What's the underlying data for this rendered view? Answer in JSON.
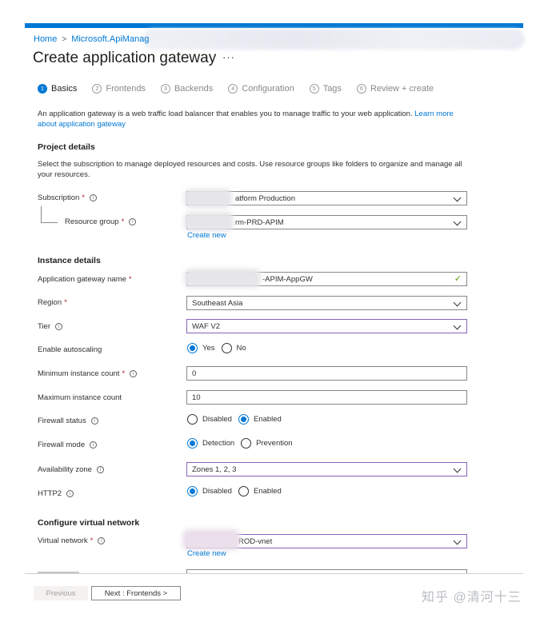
{
  "breadcrumb": {
    "home": "Home",
    "separator": ">",
    "resource": "Microsoft.ApiManag"
  },
  "page": {
    "title": "Create application gateway",
    "more": "···"
  },
  "steps": [
    {
      "num": "1",
      "label": "Basics",
      "active": true
    },
    {
      "num": "2",
      "label": "Frontends"
    },
    {
      "num": "3",
      "label": "Backends"
    },
    {
      "num": "4",
      "label": "Configuration"
    },
    {
      "num": "5",
      "label": "Tags"
    },
    {
      "num": "6",
      "label": "Review + create"
    }
  ],
  "intro": {
    "text": "An application gateway is a web traffic load balancer that enables you to manage traffic to your web application.",
    "link": "Learn more about application gateway"
  },
  "project": {
    "title": "Project details",
    "description": "Select the subscription to manage deployed resources and costs. Use resource groups like folders to organize and manage all your resources.",
    "subscription_label": "Subscription",
    "subscription_value": "atform Production",
    "resource_group_label": "Resource group",
    "resource_group_value": "rm-PRD-APIM",
    "create_new": "Create new"
  },
  "instance": {
    "title": "Instance details",
    "name_label": "Application gateway name",
    "name_value": "-APIM-AppGW",
    "region_label": "Region",
    "region_value": "Southeast Asia",
    "tier_label": "Tier",
    "tier_value": "WAF V2",
    "autoscale_label": "Enable autoscaling",
    "autoscale_yes": "Yes",
    "autoscale_no": "No",
    "min_label": "Minimum instance count",
    "min_value": "0",
    "max_label": "Maximum instance count",
    "max_value": "10",
    "fw_status_label": "Firewall status",
    "fw_status_disabled": "Disabled",
    "fw_status_enabled": "Enabled",
    "fw_mode_label": "Firewall mode",
    "fw_mode_detection": "Detection",
    "fw_mode_prevention": "Prevention",
    "az_label": "Availability zone",
    "az_value": "Zones 1, 2, 3",
    "http2_label": "HTTP2",
    "http2_disabled": "Disabled",
    "http2_enabled": "Enabled"
  },
  "vnet": {
    "title": "Configure virtual network",
    "label": "Virtual network",
    "value": "ROD-vnet",
    "create_new": "Create new"
  },
  "footer": {
    "previous": "Previous",
    "next": "Next : Frontends >"
  },
  "watermark": "知乎 @清河十三",
  "colors": {
    "accent": "#0078d4",
    "required": "#a4262c",
    "purple_border": "#8764b8",
    "valid_check": "#57a300"
  }
}
